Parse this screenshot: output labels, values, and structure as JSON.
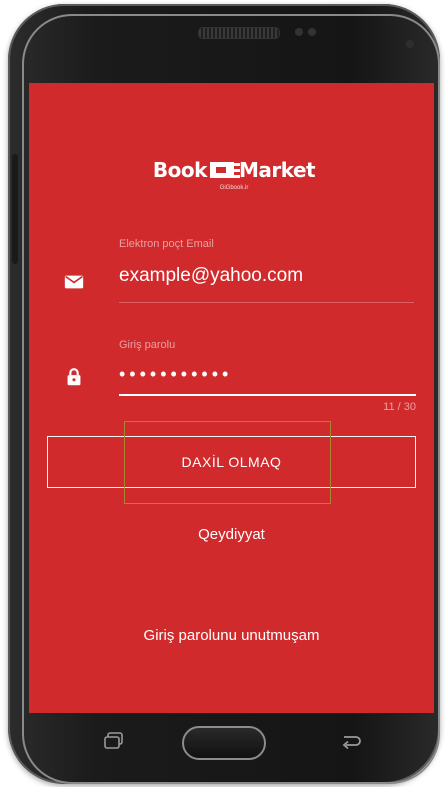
{
  "app": {
    "logo_word_left": "Book",
    "logo_word_right": "Market",
    "logo_subtitle": "GiGbook.ir"
  },
  "form": {
    "email": {
      "label": "Elektron poçt Email",
      "value": "example@yahoo.com",
      "icon": "mail-icon"
    },
    "password": {
      "label": "Giriş parolu",
      "value": "•••••••••••",
      "counter": "11 / 30",
      "icon": "lock-icon"
    },
    "login_button": "DAXİL OLMAQ",
    "register_link": "Qeydiyyat",
    "forgot_link": "Giriş parolunu unutmuşam"
  },
  "colors": {
    "screen_background": "#d02a2c",
    "text": "#ffffff",
    "focus_outline": "#a7872e"
  },
  "hardware": {
    "keys": [
      "recent-apps-key",
      "home-key",
      "back-key"
    ]
  }
}
